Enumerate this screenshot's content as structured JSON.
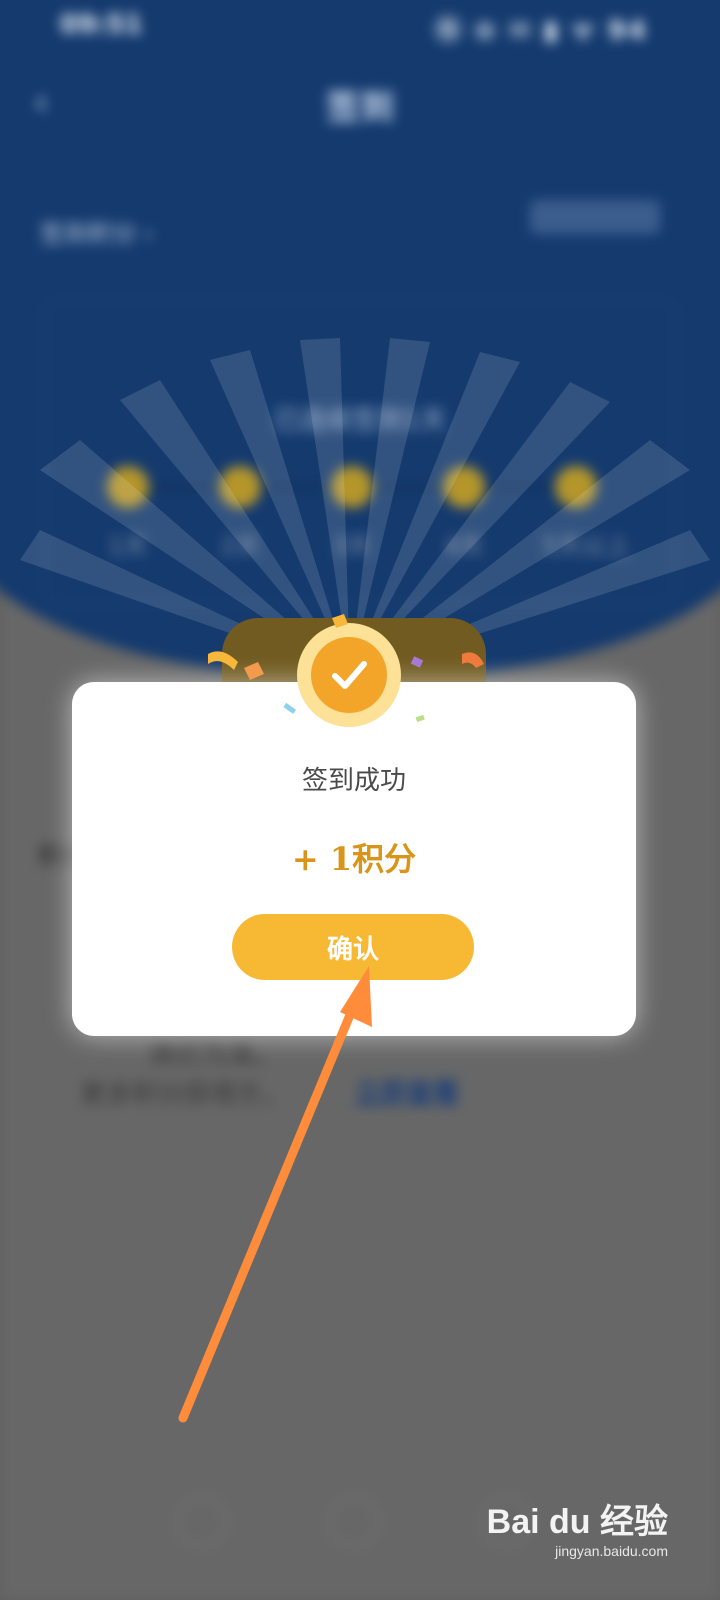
{
  "status_bar": {
    "time": "09:51",
    "icons": "Ⓝ ⊖ ✉ ▮ ᯤ 94"
  },
  "header": {
    "title": "签到",
    "subtitle": "签到积分 ›"
  },
  "checkin_card": {
    "caption": "已连续签到1天",
    "days": [
      "1天",
      "2天",
      "3天",
      "4天",
      "5天以上"
    ]
  },
  "background": {
    "heading": "积分",
    "line1": "换价为准。",
    "line2": "更多积分获得方，",
    "link": "立即查看"
  },
  "modal": {
    "title": "签到成功",
    "points": "+ 1积分",
    "confirm_label": "确认"
  },
  "watermark": {
    "brand": "Bai du 经验",
    "url": "jingyan.baidu.com"
  },
  "colors": {
    "header_blue": "#143a6e",
    "accent_orange": "#f7b934",
    "points_text": "#d8951a",
    "arrow": "#ff8c3a"
  }
}
